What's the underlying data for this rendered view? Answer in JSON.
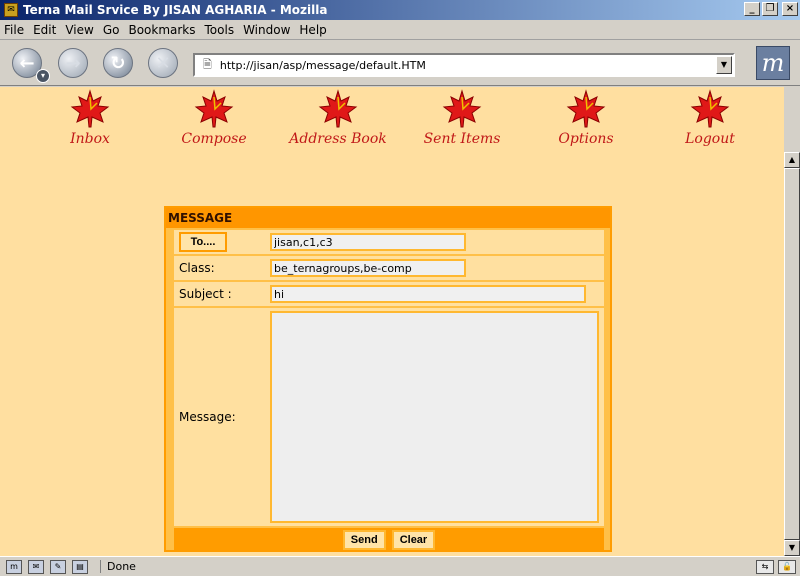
{
  "window": {
    "title": "Terna Mail Srvice By JISAN AGHARIA - Mozilla"
  },
  "menubar": {
    "items": [
      "File",
      "Edit",
      "View",
      "Go",
      "Bookmarks",
      "Tools",
      "Window",
      "Help"
    ]
  },
  "browser": {
    "url": "http://jisan/asp/message/default.HTM"
  },
  "mail_nav": {
    "items": [
      "Inbox",
      "Compose",
      "Address Book",
      "Sent Items",
      "Options",
      "Logout"
    ]
  },
  "compose": {
    "header": "MESSAGE",
    "to_button": "To....",
    "to_value": "jisan,c1,c3",
    "class_label": "Class:",
    "class_value": "be_ternagroups,be-comp",
    "subject_label": "Subject :",
    "subject_value": "hi",
    "message_label": "Message:",
    "message_value": "",
    "send_label": "Send",
    "clear_label": "Clear"
  },
  "status": {
    "text": "Done"
  },
  "colors": {
    "page_bg": "#ffdfa0",
    "accent": "#ff9600",
    "nav_label": "#c01818"
  }
}
